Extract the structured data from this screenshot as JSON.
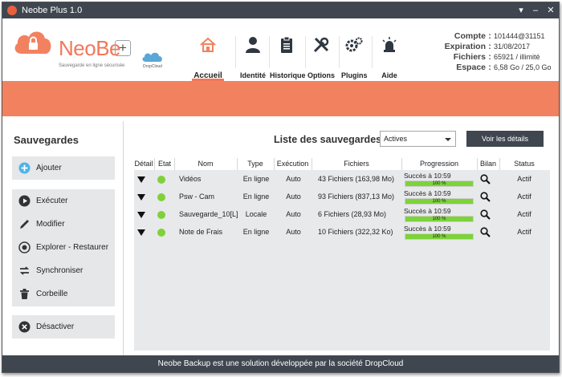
{
  "window": {
    "title": "Neobe Plus 1.0"
  },
  "logo": {
    "name": "NeoBe",
    "plus": "+",
    "tagline": "Sauvegarde en ligne sécurisée",
    "partner": "DropCloud"
  },
  "nav": [
    {
      "label": "Accueil",
      "icon": "home-icon",
      "active": true
    },
    {
      "label": "Identité",
      "icon": "user-icon"
    },
    {
      "label": "Historique",
      "icon": "clipboard-icon"
    },
    {
      "label": "Options",
      "icon": "tools-icon"
    },
    {
      "label": "Plugins",
      "icon": "gears-icon"
    },
    {
      "label": "Aide",
      "icon": "siren-icon"
    }
  ],
  "account": {
    "compte_label": "Compte",
    "compte": "101444@31151",
    "expiration_label": "Expiration",
    "expiration": "31/08/2017",
    "fichiers_label": "Fichiers",
    "fichiers": "65921 / illimité",
    "espace_label": "Espace",
    "espace": "6,58 Go / 25,0 Go"
  },
  "sidebar": {
    "title": "Sauvegardes",
    "add": "Ajouter",
    "actions": [
      "Exécuter",
      "Modifier",
      "Explorer - Restaurer",
      "Synchroniser",
      "Corbeille"
    ],
    "deactivate": "Désactiver"
  },
  "main": {
    "title": "Liste des sauvegardes",
    "filter_value": "Actives",
    "details_button": "Voir les détails",
    "columns": [
      "Détail",
      "Etat",
      "Nom",
      "Type",
      "Exécution",
      "Fichiers",
      "Progression",
      "Bilan",
      "Status"
    ],
    "rows": [
      {
        "nom": "Vidéos",
        "type": "En ligne",
        "execution": "Auto",
        "fichiers": "43 Fichiers (163,98 Mo)",
        "progress_text": "Succès à 10:59",
        "progress": 100,
        "progress_label": "100 %",
        "status": "Actif"
      },
      {
        "nom": "Psw - Cam",
        "type": "En ligne",
        "execution": "Auto",
        "fichiers": "93 Fichiers (837,13 Mo)",
        "progress_text": "Succès à 10:59",
        "progress": 100,
        "progress_label": "100 %",
        "status": "Actif"
      },
      {
        "nom": "Sauvegarde_10[L]",
        "type": "Locale",
        "execution": "Auto",
        "fichiers": "6 Fichiers (28,93 Mo)",
        "progress_text": "Succès à 10:59",
        "progress": 100,
        "progress_label": "100 %",
        "status": "Actif"
      },
      {
        "nom": "Note de Frais",
        "type": "En ligne",
        "execution": "Auto",
        "fichiers": "10 Fichiers (322,32 Ko)",
        "progress_text": "Succès à 10:59",
        "progress": 100,
        "progress_label": "100 %",
        "status": "Actif"
      }
    ]
  },
  "footer": {
    "text": "Neobe Backup est une solution développée par la société DropCloud"
  },
  "colors": {
    "accent": "#f2825f",
    "dark": "#3f4650",
    "ok": "#7fd13b"
  }
}
